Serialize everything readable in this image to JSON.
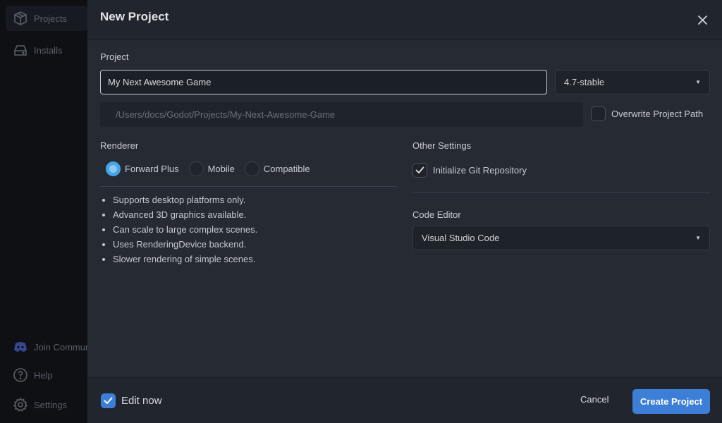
{
  "sidebar": {
    "items": [
      {
        "label": "Projects",
        "icon": "box-icon"
      },
      {
        "label": "Installs",
        "icon": "drive-icon"
      }
    ],
    "bottom_items": [
      {
        "label": "Join Community",
        "icon": "discord-icon"
      },
      {
        "label": "Help",
        "icon": "help-icon"
      },
      {
        "label": "Settings",
        "icon": "gear-icon"
      }
    ]
  },
  "dialog": {
    "title": "New Project",
    "project_label": "Project",
    "project_name_value": "My Next Awesome Game",
    "version_value": "4.7-stable",
    "path_value": "/Users/docs/Godot/Projects/My-Next-Awesome-Game",
    "overwrite_label": "Overwrite Project Path",
    "renderer": {
      "label": "Renderer",
      "options": [
        "Forward Plus",
        "Mobile",
        "Compatible"
      ],
      "selected": "Forward Plus",
      "notes": [
        "Supports desktop platforms only.",
        "Advanced 3D graphics available.",
        "Can scale to large complex scenes.",
        "Uses RenderingDevice backend.",
        "Slower rendering of simple scenes."
      ]
    },
    "other_settings": {
      "label": "Other Settings",
      "git_label": "Initialize Git Repository",
      "git_checked": true
    },
    "code_editor": {
      "label": "Code Editor",
      "value": "Visual Studio Code"
    },
    "footer": {
      "edit_now_label": "Edit now",
      "edit_now_checked": true,
      "cancel_label": "Cancel",
      "create_label": "Create Project"
    }
  },
  "colors": {
    "accent": "#3d7fd6",
    "radio_selected": "#45a5e8",
    "dialog_bg": "#252a33",
    "sidebar_bg": "#0e1014"
  }
}
